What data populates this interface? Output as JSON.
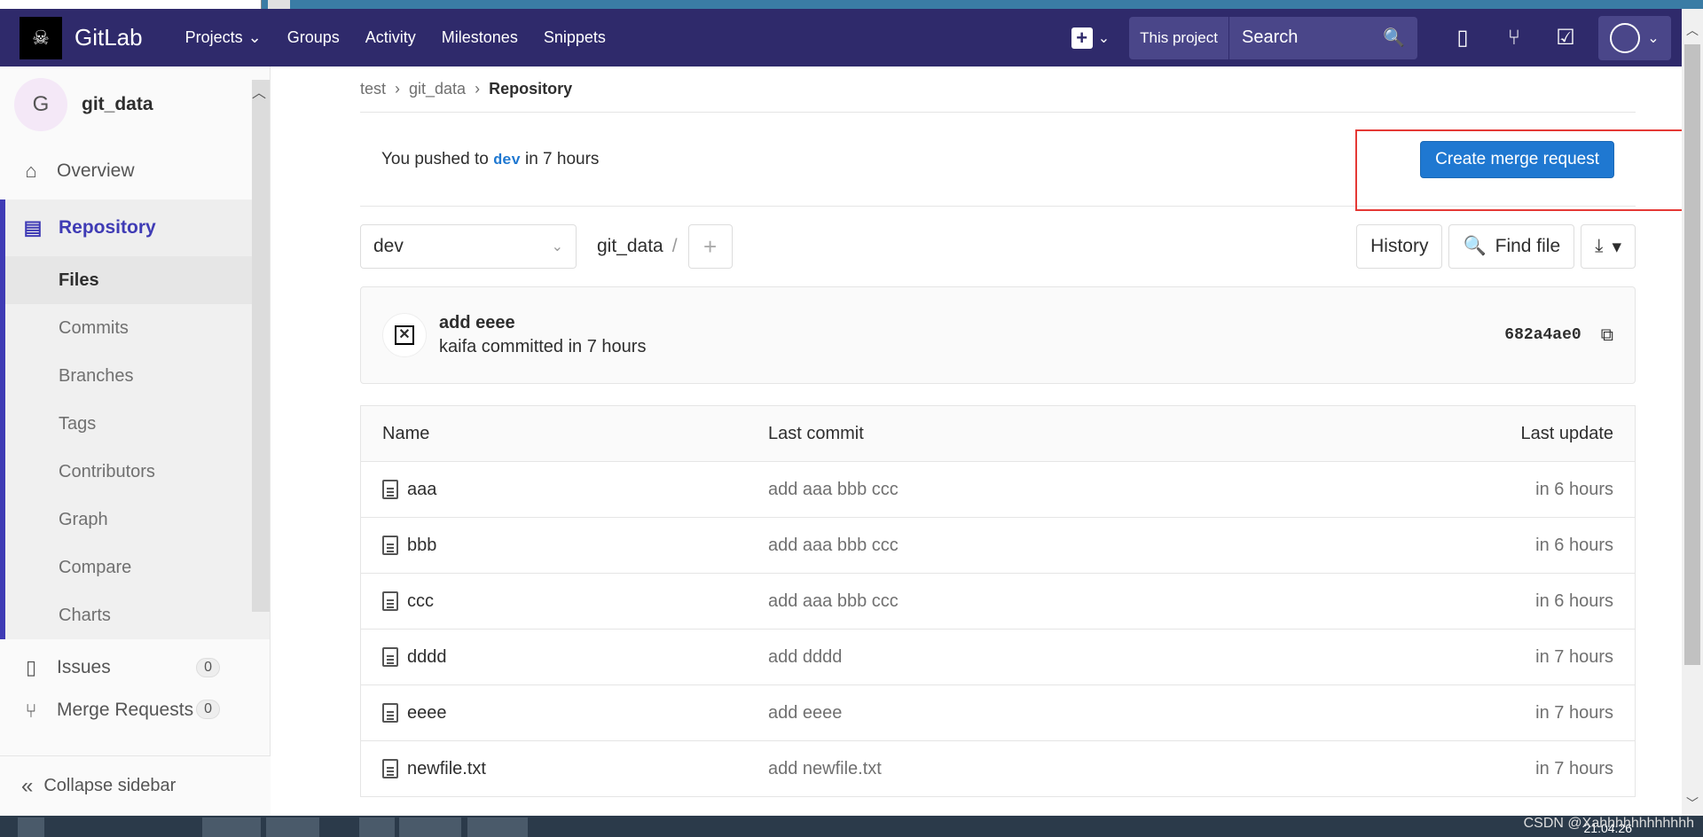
{
  "navbar": {
    "brand": "GitLab",
    "links": [
      "Projects",
      "Groups",
      "Activity",
      "Milestones",
      "Snippets"
    ],
    "search_scope": "This project",
    "search_placeholder": "Search"
  },
  "sidebar": {
    "project_initial": "G",
    "project_name": "git_data",
    "overview": "Overview",
    "repository": "Repository",
    "repo_items": [
      "Files",
      "Commits",
      "Branches",
      "Tags",
      "Contributors",
      "Graph",
      "Compare",
      "Charts"
    ],
    "issues": "Issues",
    "issues_count": "0",
    "merge_requests": "Merge Requests",
    "mr_count": "0",
    "collapse": "Collapse sidebar"
  },
  "breadcrumb": {
    "items": [
      "test",
      "git_data"
    ],
    "current": "Repository"
  },
  "push_bar": {
    "prefix": "You pushed to",
    "branch": "dev",
    "suffix": "in 7 hours",
    "button": "Create merge request"
  },
  "tree": {
    "branch": "dev",
    "path": "git_data",
    "path_sep": "/",
    "history": "History",
    "find_file": "Find file"
  },
  "commit": {
    "title": "add eeee",
    "meta": "kaifa committed in 7 hours",
    "sha": "682a4ae0"
  },
  "table": {
    "headers": [
      "Name",
      "Last commit",
      "Last update"
    ],
    "rows": [
      {
        "name": "aaa",
        "commit": "add aaa bbb ccc",
        "updated": "in 6 hours"
      },
      {
        "name": "bbb",
        "commit": "add aaa bbb ccc",
        "updated": "in 6 hours"
      },
      {
        "name": "ccc",
        "commit": "add aaa bbb ccc",
        "updated": "in 6 hours"
      },
      {
        "name": "dddd",
        "commit": "add dddd",
        "updated": "in 7 hours"
      },
      {
        "name": "eeee",
        "commit": "add eeee",
        "updated": "in 7 hours"
      },
      {
        "name": "newfile.txt",
        "commit": "add newfile.txt",
        "updated": "in 7 hours"
      }
    ]
  },
  "taskbar": {
    "watermark": "CSDN @Xahhhhhhhhhhhh",
    "clock": "21:04:26"
  },
  "colors": {
    "navbar": "#2f2a6b",
    "accent": "#3f3bb5",
    "primary_button": "#1f78d1",
    "highlight": "#e53935"
  }
}
